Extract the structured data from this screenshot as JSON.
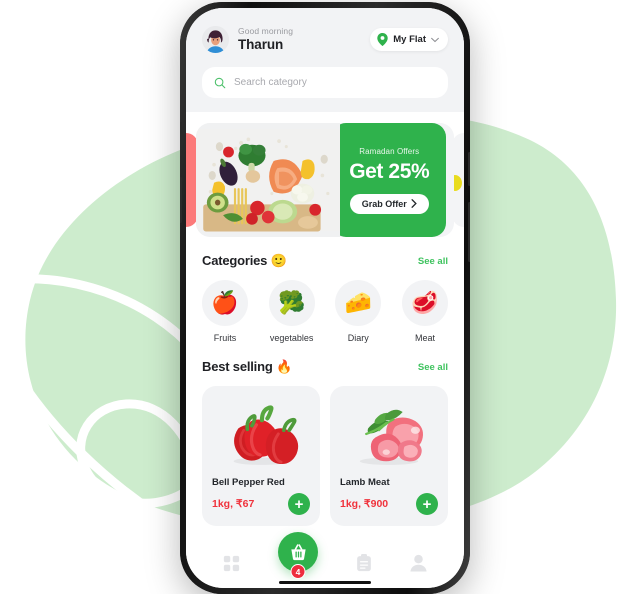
{
  "app": {
    "accent_green": "#2fb24c",
    "link_green": "#3fc35f",
    "price_red": "#f0323c",
    "badge_red": "#ee2d3e",
    "panel_gray": "#f2f3f5",
    "peek_card_red": "#fc7a7a"
  },
  "header": {
    "greeting": "Good morning",
    "user_name": "Tharun",
    "avatar_icon": "avatar-person",
    "location": {
      "label": "My Flat",
      "pin_icon": "location-pin-icon",
      "chevron_icon": "chevron-down-icon"
    }
  },
  "search": {
    "placeholder": "Search category",
    "icon": "search-icon"
  },
  "banner": {
    "eyebrow": "Ramadan Offers",
    "headline": "Get 25%",
    "cta_label": "Grab Offer",
    "cta_arrow": "chevron-right-icon",
    "photo_alt": "fresh-vegetables-photo"
  },
  "categories_section": {
    "title": "Categories",
    "title_emoji": "🙂",
    "see_all": "See all",
    "items": [
      {
        "label": "Fruits",
        "emoji": "🍎",
        "icon": "apple-icon"
      },
      {
        "label": "vegetables",
        "emoji": "🥦",
        "icon": "broccoli-icon"
      },
      {
        "label": "Diary",
        "emoji": "🧀",
        "icon": "cheese-icon"
      },
      {
        "label": "Meat",
        "emoji": "🥩",
        "icon": "steak-icon"
      }
    ]
  },
  "best_selling_section": {
    "title": "Best selling",
    "title_emoji": "🔥",
    "see_all": "See all",
    "products": [
      {
        "name": "Bell Pepper Red",
        "price": "1kg, ₹67",
        "emoji": "🫑",
        "add_label": "+"
      },
      {
        "name": "Lamb Meat",
        "price": "1kg, ₹900",
        "emoji": "🥩",
        "add_label": "+"
      }
    ]
  },
  "bottom_nav": {
    "items": [
      {
        "icon": "grid-dashboard-icon",
        "label": ""
      },
      {
        "icon": "orders-clipboard-icon",
        "label": ""
      },
      {
        "icon": "profile-person-icon",
        "label": ""
      }
    ],
    "cart": {
      "icon": "shopping-basket-icon",
      "badge_count": "4"
    }
  }
}
